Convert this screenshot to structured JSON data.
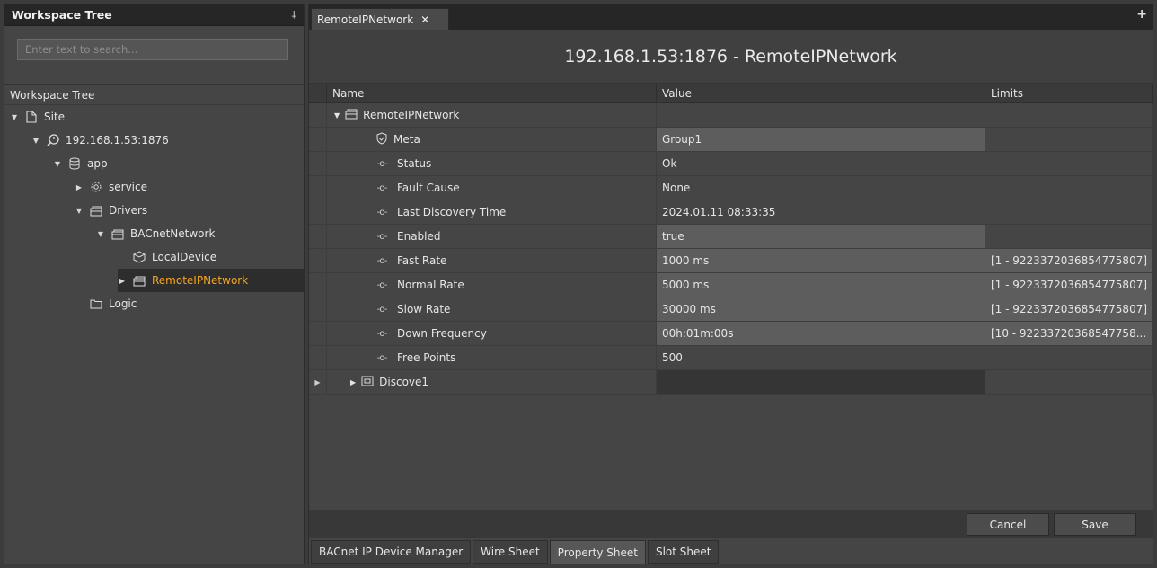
{
  "left": {
    "header_title": "Workspace Tree",
    "pin": "ṙ",
    "search_placeholder": "Enter text to search...",
    "tree_title": "Workspace Tree",
    "nodes": [
      {
        "label": "Site"
      },
      {
        "label": "192.168.1.53:1876"
      },
      {
        "label": "app"
      },
      {
        "label": "service"
      },
      {
        "label": "Drivers"
      },
      {
        "label": "BACnetNetwork"
      },
      {
        "label": "LocalDevice"
      },
      {
        "label": "RemoteIPNetwork"
      },
      {
        "label": "Logic"
      }
    ]
  },
  "right": {
    "tab_label": "RemoteIPNetwork",
    "tab_close": "✕",
    "add_tab": "+",
    "title": "192.168.1.53:1876 - RemoteIPNetwork",
    "columns": {
      "name": "Name",
      "value": "Value",
      "limits": "Limits"
    },
    "rows": [
      {
        "name": "RemoteIPNetwork",
        "value": "",
        "limits": ""
      },
      {
        "name": "Meta",
        "value": "Group1",
        "limits": ""
      },
      {
        "name": "Status",
        "value": "Ok",
        "limits": ""
      },
      {
        "name": "Fault Cause",
        "value": "None",
        "limits": ""
      },
      {
        "name": "Last Discovery Time",
        "value": "2024.01.11 08:33:35",
        "limits": ""
      },
      {
        "name": "Enabled",
        "value": "true",
        "limits": ""
      },
      {
        "name": "Fast Rate",
        "value": "1000 ms",
        "limits": "[1 - 9223372036854775807]"
      },
      {
        "name": "Normal Rate",
        "value": "5000 ms",
        "limits": "[1 - 9223372036854775807]"
      },
      {
        "name": "Slow Rate",
        "value": "30000 ms",
        "limits": "[1 - 9223372036854775807]"
      },
      {
        "name": "Down Frequency",
        "value": "00h:01m:00s",
        "limits": "[10 - 92233720368547758..."
      },
      {
        "name": "Free Points",
        "value": "500",
        "limits": ""
      },
      {
        "name": "Discove1",
        "value": "",
        "limits": ""
      }
    ],
    "buttons": {
      "cancel": "Cancel",
      "save": "Save"
    },
    "bottom_tabs": [
      "BACnet IP Device Manager",
      "Wire Sheet",
      "Property Sheet",
      "Slot Sheet"
    ]
  },
  "colors": {
    "accent": "#f5a623",
    "panel": "#454545",
    "header": "#262626"
  }
}
